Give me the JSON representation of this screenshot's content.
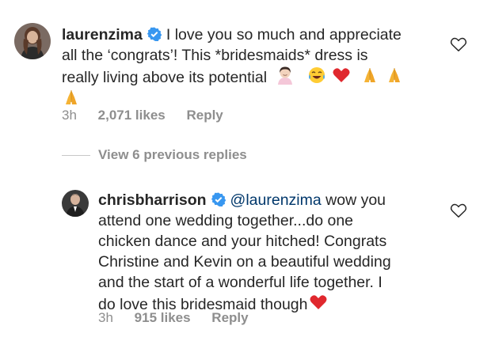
{
  "comment": {
    "username": "laurenzima",
    "line1": "I love you so much and appreciate",
    "line2": "all the ‘congrats’! This *bridesmaids* dress is",
    "line3": "really living above its potential",
    "time": "3h",
    "likes": "2,071 likes",
    "reply": "Reply"
  },
  "view_replies": "View 6 previous replies",
  "reply_comment": {
    "username": "chrisbharrison",
    "mention": "@laurenzima",
    "line1": "wow you",
    "line2": "attend one wedding together...do one",
    "line3": "chicken dance and your hitched!  Congrats",
    "line4": "Christine and Kevin on a beautiful wedding",
    "line5": "and the start of a wonderful life together.  I",
    "line6": "do love this bridesmaid though",
    "time": "3h",
    "likes": "915 likes",
    "reply": "Reply"
  },
  "icons": {
    "verified": "verified-badge-icon",
    "like": "heart-outline-icon"
  },
  "colors": {
    "verified": "#3897f0",
    "mention": "#00376b",
    "muted": "#8e8e8e",
    "emoji_heart": "#e0282e"
  }
}
